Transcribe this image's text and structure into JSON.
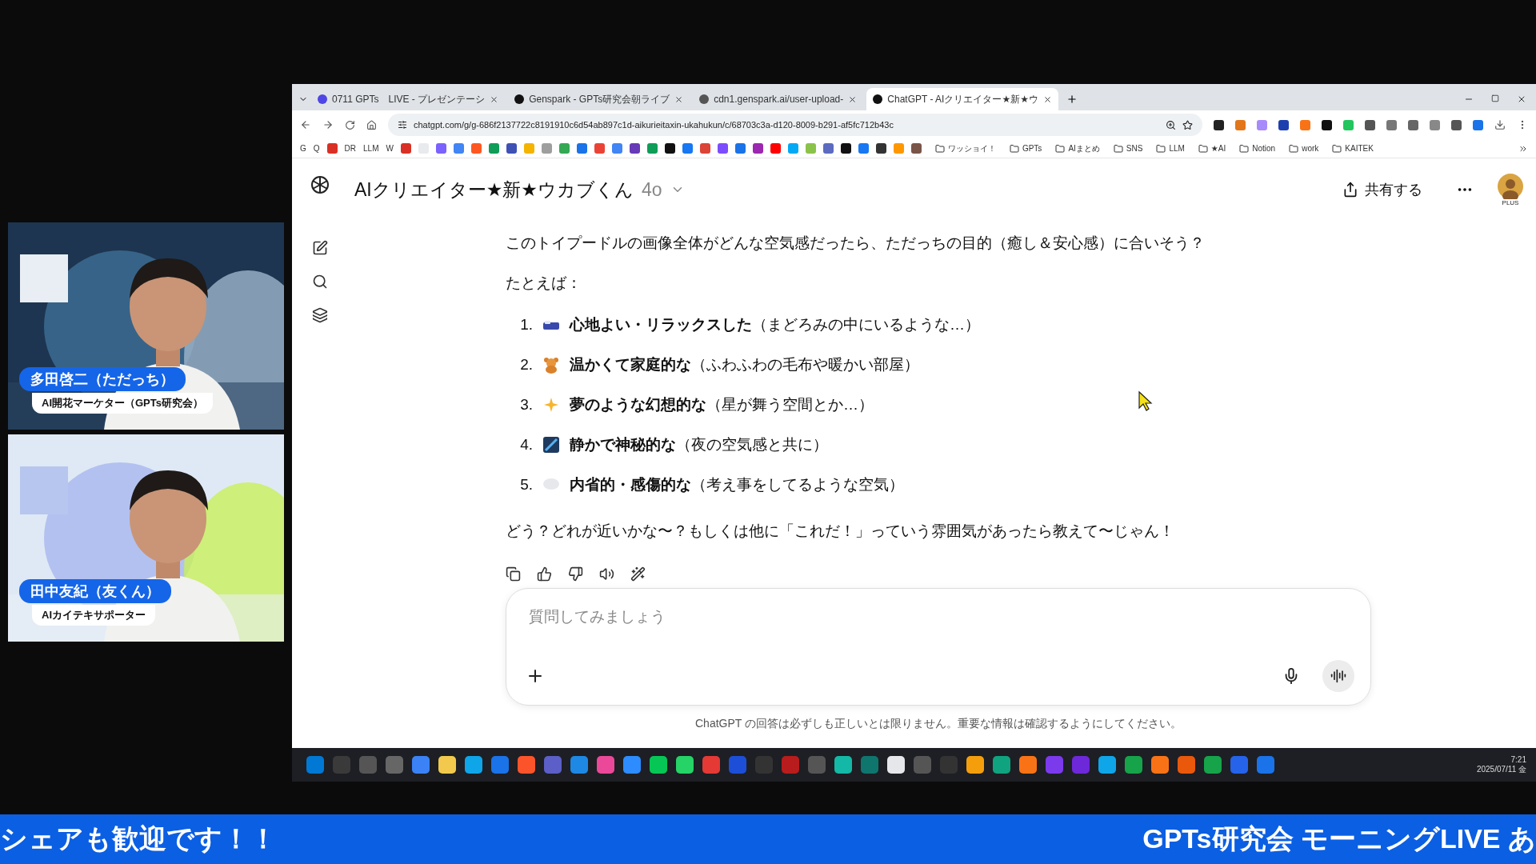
{
  "stream": {
    "panels": [
      {
        "name": "多田啓二（ただっち）",
        "role": "AI開花マーケター（GPTs研究会）",
        "kind": "picture"
      },
      {
        "name": "田中友紀（友くん）",
        "role": "AIカイテキサポーター",
        "kind": "picture"
      }
    ],
    "ticker": [
      "シェアも歓迎です！！",
      "GPTs研究会 モーニングLIVE あ"
    ]
  },
  "browser": {
    "tabs": [
      {
        "label": "0711 GPTs　LIVE - プレゼンテーシ",
        "selected": false
      },
      {
        "label": "Genspark - GPTs研究会朝ライブ",
        "selected": false
      },
      {
        "label": "cdn1.genspark.ai/user-upload-",
        "selected": false
      },
      {
        "label": "ChatGPT - AIクリエイター★新★ウ",
        "selected": true
      }
    ],
    "url": "chatgpt.com/g/g-686f2137722c8191910c6d54ab897c1d-aikurieitaxin-ukahukun/c/68703c3a-d120-8009-b291-af5fc712b43c",
    "bookmarks": [
      {
        "label": "G",
        "kind": "text"
      },
      {
        "label": "Q",
        "kind": "text"
      },
      {
        "kind": "icon"
      },
      {
        "label": "DR",
        "kind": "text"
      },
      {
        "label": "LLM",
        "kind": "text"
      },
      {
        "label": "W",
        "kind": "text"
      }
    ],
    "folders": [
      "ワッショイ！",
      "GPTs",
      "AIまとめ",
      "SNS",
      "LLM",
      "★AI",
      "Notion",
      "work",
      "KAITEK"
    ]
  },
  "chat": {
    "title": "AIクリエイター★新★ウカブくん",
    "model": "4o",
    "share": "共有する",
    "plan": "PLUS",
    "intro": "このトイプードルの画像全体がどんな空気感だったら、ただっちの目的（癒し＆安心感）に合いそう？",
    "lead": "たとえば：",
    "options": [
      {
        "number": "1.",
        "text": "**心地よい・リラックスした**（まどろみの中にいるような…）"
      },
      {
        "number": "2.",
        "text": "**温かくて家庭的な**（ふわふわの毛布や暖かい部屋）"
      },
      {
        "number": "3.",
        "text": "**夢のような幻想的な**（星が舞う空間とか…）"
      },
      {
        "number": "4.",
        "text": "**静かで神秘的な**（夜の空気感と共に）"
      },
      {
        "number": "5.",
        "text": "**内省的・感傷的な**（考え事をしてるような空気）"
      }
    ],
    "closing": "どう？どれが近いかな〜？もしくは他に「これだ！」っていう雰囲気があったら教えて〜じゃん！",
    "placeholder": "質問してみましょう",
    "disclaimer": "ChatGPT の回答は必ずしも正しいとは限りません。重要な情報は確認するようにしてください。"
  },
  "taskbar": {
    "time": "7:21",
    "date": "2025/07/11 金"
  }
}
